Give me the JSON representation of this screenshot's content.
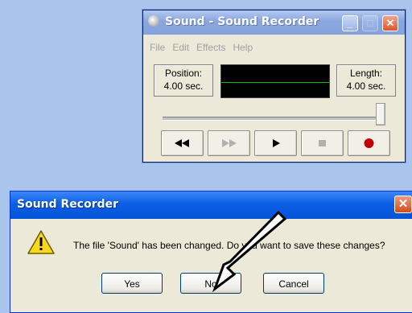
{
  "recorder_window": {
    "title": "Sound - Sound Recorder",
    "menu": [
      "File",
      "Edit",
      "Effects",
      "Help"
    ],
    "position_label": "Position:",
    "position_value": "4.00 sec.",
    "length_label": "Length:",
    "length_value": "4.00 sec.",
    "slider_value": 1.0,
    "controls": [
      "seek-to-start-icon",
      "seek-to-end-icon",
      "play-icon",
      "stop-icon",
      "record-icon"
    ],
    "enabled_controls": [
      "seek-to-start-icon",
      "play-icon",
      "record-icon"
    ],
    "record_color": "#c00000"
  },
  "dialog": {
    "title": "Sound Recorder",
    "message": "The file 'Sound' has been changed. Do you want to save these changes?",
    "icon": "warning-icon",
    "buttons": {
      "yes": "Yes",
      "no": "No",
      "cancel": "Cancel"
    }
  },
  "annotation": {
    "arrow_target": "No"
  }
}
